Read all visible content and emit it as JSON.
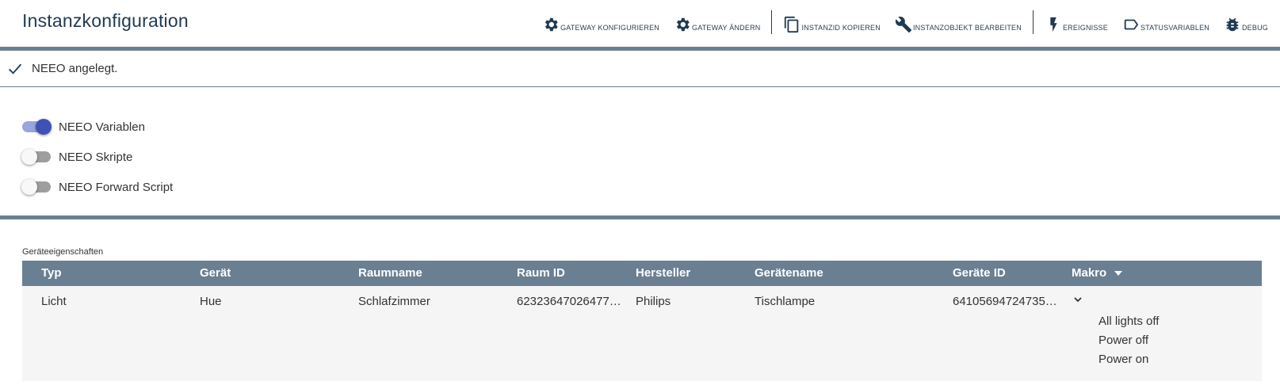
{
  "header": {
    "title": "Instanzkonfiguration",
    "toolbar": {
      "gateway_configure": "Gateway konfigurieren",
      "gateway_change": "Gateway ändern",
      "copy_instance_id": "InstanzID kopieren",
      "edit_instance_object": "Instanzobjekt bearbeiten",
      "events": "Ereignisse",
      "status_variables": "Statusvariablen",
      "debug": "Debug"
    }
  },
  "status": {
    "message": "NEEO angelegt."
  },
  "toggles": [
    {
      "label": "NEEO Variablen",
      "checked": true
    },
    {
      "label": "NEEO Skripte",
      "checked": false
    },
    {
      "label": "NEEO Forward Script",
      "checked": false
    }
  ],
  "device_table": {
    "caption": "Geräteeigenschaften",
    "columns": [
      "Typ",
      "Gerät",
      "Raumname",
      "Raum ID",
      "Hersteller",
      "Gerätename",
      "Geräte ID",
      "Makro"
    ],
    "row": {
      "type": "Licht",
      "device": "Hue",
      "room_name": "Schlafzimmer",
      "room_id": "62323647026477…",
      "manufacturer": "Philips",
      "device_name": "Tischlampe",
      "device_id": "64105694724735…"
    },
    "macros": [
      "All lights off",
      "Power off",
      "Power on"
    ]
  },
  "colors": {
    "accent": "#3f51b5",
    "header_bar": "#6b7f92",
    "title": "#1f3a52"
  }
}
